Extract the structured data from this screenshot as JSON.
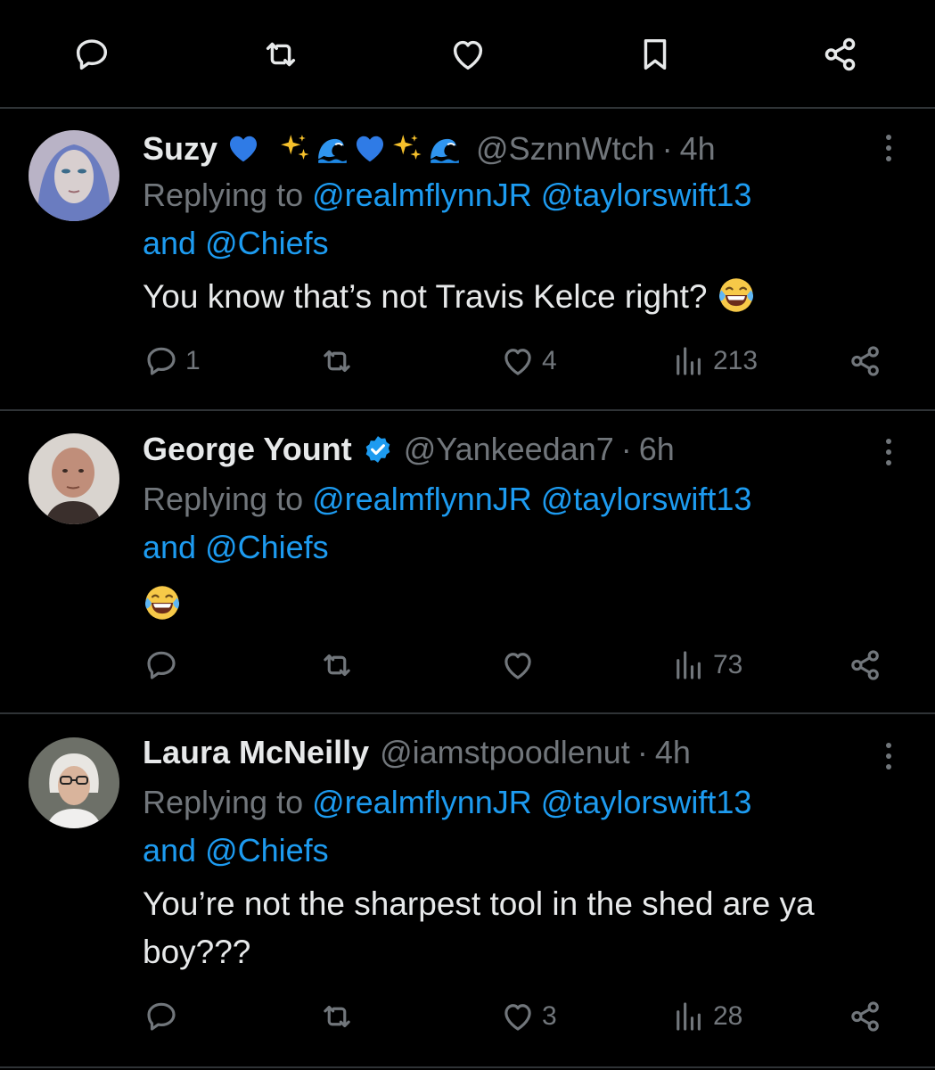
{
  "tweets": [
    {
      "name": "Suzy",
      "handle": "@SznnWtch",
      "separator": "·",
      "time": "4h",
      "replying_prefix": "Replying to",
      "mention1": "@realmflynnJR",
      "mention2": "@taylorswift13",
      "and_text": "and",
      "mention3": "@Chiefs",
      "text": "You know that’s not Travis Kelce right?",
      "reply_count": "1",
      "retweet_count": "",
      "like_count": "4",
      "view_count": "213"
    },
    {
      "name": "George Yount",
      "handle": "@Yankeedan7",
      "separator": "·",
      "time": "6h",
      "replying_prefix": "Replying to",
      "mention1": "@realmflynnJR",
      "mention2": "@taylorswift13",
      "and_text": "and",
      "mention3": "@Chiefs",
      "text": "",
      "reply_count": "",
      "retweet_count": "",
      "like_count": "",
      "view_count": "73"
    },
    {
      "name": "Laura McNeilly",
      "handle": "@iamstpoodlenut",
      "separator": "·",
      "time": "4h",
      "replying_prefix": "Replying to",
      "mention1": "@realmflynnJR",
      "mention2": "@taylorswift13",
      "and_text": "and",
      "mention3": "@Chiefs",
      "text_line1": "You’re not the sharpest tool in the shed are ya",
      "text_line2": "boy???",
      "reply_count": "",
      "retweet_count": "",
      "like_count": "3",
      "view_count": "28"
    }
  ],
  "colors": {
    "background": "#000000",
    "text": "#e7e9ea",
    "muted": "#71767b",
    "accent": "#1d9bf0",
    "divider": "#2f3336"
  },
  "icons": {
    "top_bar": [
      "reply-icon",
      "retweet-icon",
      "like-icon",
      "bookmark-icon",
      "share-icon"
    ],
    "action": [
      "reply-icon",
      "retweet-icon",
      "like-icon",
      "views-icon",
      "share-icon"
    ]
  }
}
